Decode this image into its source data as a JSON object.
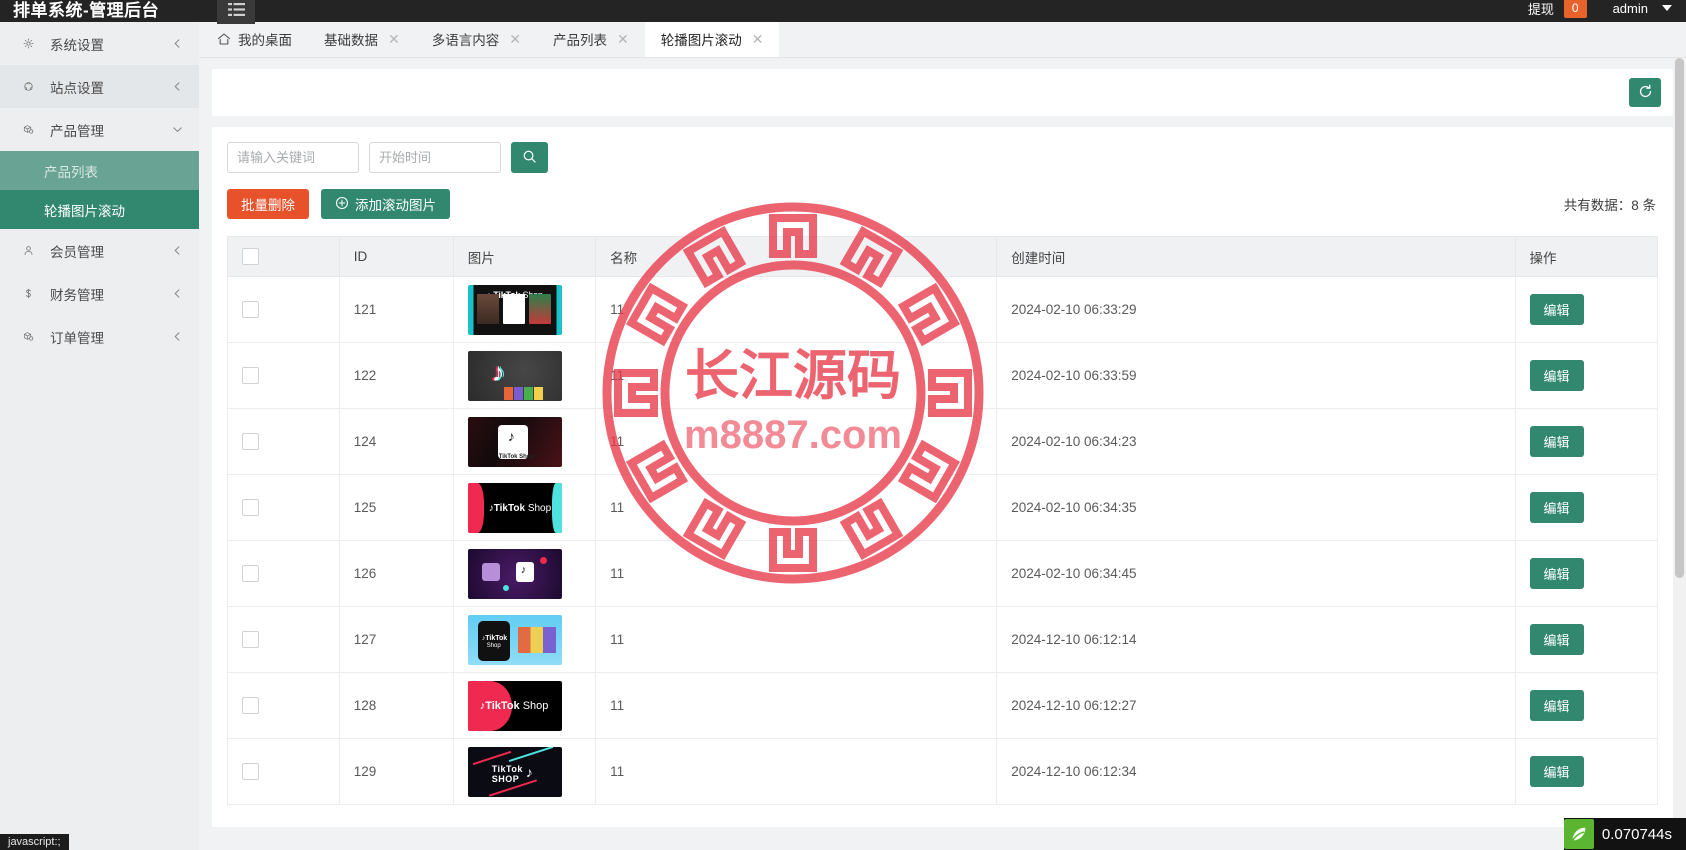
{
  "topbar": {
    "brand": "排单系统-管理后台",
    "menu_toggle_icon": "hamburger-icon",
    "withdraw_label": "提现",
    "withdraw_count": "0",
    "user": "admin"
  },
  "sidebar": {
    "items": [
      {
        "label": "系统设置",
        "icon": "gear-icon",
        "arrow": "chevron-right-icon",
        "state": "collapsed"
      },
      {
        "label": "站点设置",
        "icon": "globe-icon",
        "arrow": "chevron-right-icon",
        "state": "collapsed"
      },
      {
        "label": "产品管理",
        "icon": "box-icon",
        "arrow": "chevron-down-icon",
        "state": "expanded"
      },
      {
        "label": "会员管理",
        "icon": "user-icon",
        "arrow": "chevron-right-icon",
        "state": "collapsed"
      },
      {
        "label": "财务管理",
        "icon": "dollar-icon",
        "arrow": "chevron-right-icon",
        "state": "collapsed"
      },
      {
        "label": "订单管理",
        "icon": "box-icon",
        "arrow": "chevron-right-icon",
        "state": "collapsed"
      }
    ],
    "sub_items": [
      {
        "label": "产品列表",
        "state": "visited"
      },
      {
        "label": "轮播图片滚动",
        "state": "active"
      }
    ]
  },
  "tabs": [
    {
      "label": "我的桌面",
      "icon": "home-icon",
      "closable": false,
      "active": false
    },
    {
      "label": "基础数据",
      "closable": true,
      "active": false
    },
    {
      "label": "多语言内容",
      "closable": true,
      "active": false
    },
    {
      "label": "产品列表",
      "closable": true,
      "active": false
    },
    {
      "label": "轮播图片滚动",
      "closable": true,
      "active": true
    }
  ],
  "toolbar": {
    "refresh_icon": "refresh-icon"
  },
  "filters": {
    "keyword_value": "",
    "keyword_placeholder": "请输入关键词",
    "date_value": "",
    "date_placeholder": "开始时间",
    "search_icon": "search-icon"
  },
  "actions": {
    "batch_delete": "批量删除",
    "add_image": "添加滚动图片",
    "add_icon": "plus-circle-icon",
    "total_text": "共有数据：8 条"
  },
  "table": {
    "columns": [
      "",
      "ID",
      "图片",
      "名称",
      "创建时间",
      "操作"
    ],
    "select_all_checked": false,
    "edit_label": "编辑",
    "rows": [
      {
        "id": "121",
        "name": "11",
        "created": "2024-02-10 06:33:29",
        "thumb": "tiktok-shop-phones",
        "checked": false
      },
      {
        "id": "122",
        "name": "11",
        "created": "2024-02-10 06:33:59",
        "thumb": "tiktok-note-bags",
        "checked": false
      },
      {
        "id": "124",
        "name": "11",
        "created": "2024-02-10 06:34:23",
        "thumb": "tiktok-shop-hand-phone",
        "checked": false
      },
      {
        "id": "125",
        "name": "11",
        "created": "2024-02-10 06:34:35",
        "thumb": "tiktok-shop-banner",
        "checked": false
      },
      {
        "id": "126",
        "name": "11",
        "created": "2024-02-10 06:34:45",
        "thumb": "tiktok-purple-cart",
        "checked": false
      },
      {
        "id": "127",
        "name": "11",
        "created": "2024-12-10 06:12:14",
        "thumb": "tiktok-shop-clothes",
        "checked": false
      },
      {
        "id": "128",
        "name": "11",
        "created": "2024-12-10 06:12:27",
        "thumb": "tiktok-shop-pink-black",
        "checked": false
      },
      {
        "id": "129",
        "name": "11",
        "created": "2024-12-10 06:12:34",
        "thumb": "tiktok-shop-dark-streaks",
        "checked": false
      }
    ]
  },
  "watermark": {
    "title": "长江源码",
    "domain": "m8887.com",
    "color": "#e8394a"
  },
  "statusbar": {
    "js_text": "javascript:;",
    "perf_time": "0.070744s",
    "perf_icon": "leaf-icon"
  },
  "colors": {
    "accent_green": "#31886f",
    "danger_orange": "#e8522b",
    "topbar_dark": "#242424",
    "sidebar_bg": "#eceef0"
  }
}
